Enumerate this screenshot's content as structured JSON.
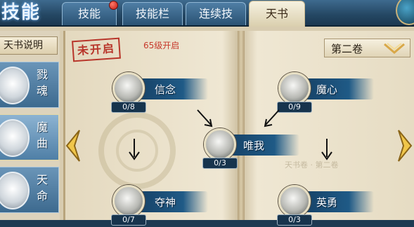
{
  "game_title": "技能",
  "tabs": [
    {
      "label": "技能",
      "active": false
    },
    {
      "label": "技能栏",
      "active": false
    },
    {
      "label": "连续技",
      "active": false
    },
    {
      "label": "天书",
      "active": true
    }
  ],
  "sidebar": {
    "header": "天书说明",
    "items": [
      {
        "label": "戮魂",
        "active": false
      },
      {
        "label": "魔曲",
        "active": true
      },
      {
        "label": "天命",
        "active": false
      }
    ]
  },
  "book": {
    "stamp": "未开启",
    "unlock_text": "65级开启",
    "volume": "第二卷",
    "faint_text": "天书卷 · 第二卷"
  },
  "nodes": [
    {
      "id": "xinnian",
      "name": "信念",
      "count": "0/8"
    },
    {
      "id": "moxin",
      "name": "魔心",
      "count": "0/9"
    },
    {
      "id": "weiwo",
      "name": "唯我",
      "count": "0/3"
    },
    {
      "id": "duoshen",
      "name": "夺神",
      "count": "0/7"
    },
    {
      "id": "yingyong",
      "name": "英勇",
      "count": "0/3"
    }
  ],
  "colors": {
    "accent": "#2a5273",
    "stamp_red": "#b8352a",
    "nav_gold": "#f0c64a"
  }
}
